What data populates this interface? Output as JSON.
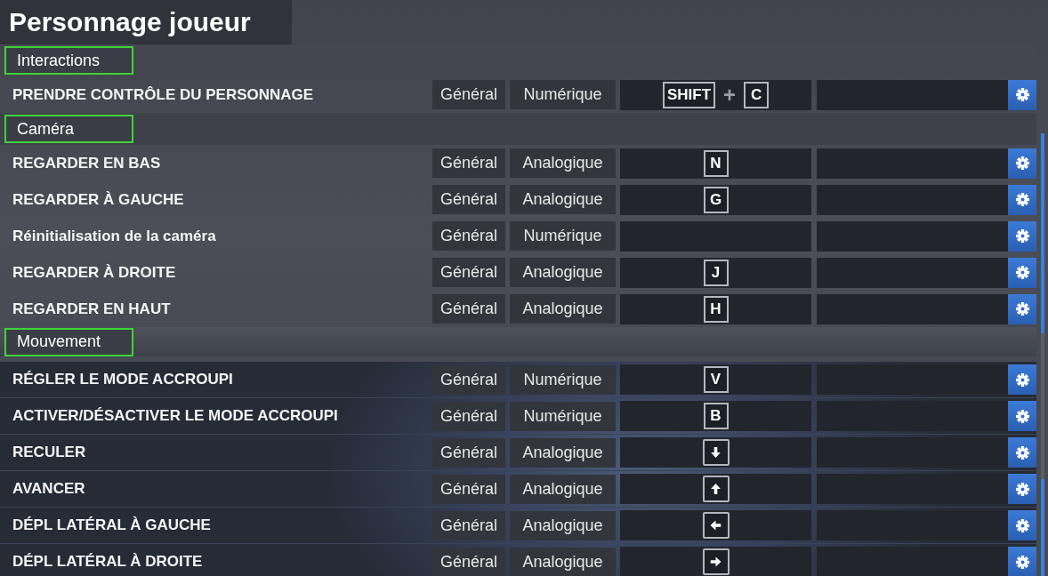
{
  "title": "Personnage joueur",
  "sections": [
    {
      "label": "Interactions",
      "highlighted": true,
      "rows": [
        {
          "action": "PRENDRE CONTRÔLE DU PERSONNAGE",
          "category": "Général",
          "input_type": "Numérique",
          "primary": [
            {
              "kind": "key",
              "label": "SHIFT"
            },
            {
              "kind": "plus",
              "label": "+"
            },
            {
              "kind": "key",
              "label": "C"
            }
          ]
        }
      ]
    },
    {
      "label": "Caméra",
      "highlighted": true,
      "rows": [
        {
          "action": "REGARDER EN BAS",
          "category": "Général",
          "input_type": "Analogique",
          "primary": [
            {
              "kind": "key",
              "label": "N"
            }
          ]
        },
        {
          "action": "REGARDER À GAUCHE",
          "category": "Général",
          "input_type": "Analogique",
          "primary": [
            {
              "kind": "key",
              "label": "G"
            }
          ]
        },
        {
          "action": "Réinitialisation de la caméra",
          "category": "Général",
          "input_type": "Numérique"
        },
        {
          "action": "REGARDER À DROITE",
          "category": "Général",
          "input_type": "Analogique",
          "primary": [
            {
              "kind": "key",
              "label": "J"
            }
          ]
        },
        {
          "action": "REGARDER EN HAUT",
          "category": "Général",
          "input_type": "Analogique",
          "primary": [
            {
              "kind": "key",
              "label": "H"
            }
          ]
        }
      ]
    },
    {
      "label": "Mouvement",
      "highlighted": true,
      "rows": [
        {
          "action": "RÉGLER LE MODE ACCROUPI",
          "category": "Général",
          "input_type": "Numérique",
          "primary": [
            {
              "kind": "key",
              "label": "V"
            }
          ]
        },
        {
          "action": "ACTIVER/DÉSACTIVER LE MODE ACCROUPI",
          "category": "Général",
          "input_type": "Numérique",
          "primary": [
            {
              "kind": "key",
              "label": "B"
            }
          ]
        },
        {
          "action": "RECULER",
          "category": "Général",
          "input_type": "Analogique",
          "primary": [
            {
              "kind": "down"
            }
          ]
        },
        {
          "action": "AVANCER",
          "category": "Général",
          "input_type": "Analogique",
          "primary": [
            {
              "kind": "up"
            }
          ]
        },
        {
          "action": "DÉPL LATÉRAL À GAUCHE",
          "category": "Général",
          "input_type": "Analogique",
          "primary": [
            {
              "kind": "left"
            }
          ]
        },
        {
          "action": "DÉPL LATÉRAL À DROITE",
          "category": "Général",
          "input_type": "Analogique",
          "primary": [
            {
              "kind": "right"
            }
          ]
        }
      ]
    }
  ]
}
